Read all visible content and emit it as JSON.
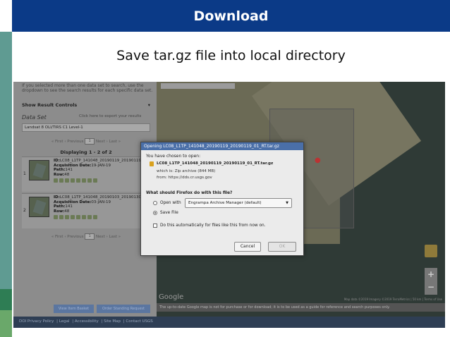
{
  "slide": {
    "title": "Download",
    "subtitle": "Save tar.gz file into local directory"
  },
  "left_panel": {
    "hint": "If you selected more than one data set to search, use the dropdown to see the search results for each specific data set.",
    "show_result_controls": "Show Result Controls",
    "data_set_label": "Data Set",
    "export_link": "Click here to export your results",
    "data_set_value": "Landsat 8 OLI/TIRS C1 Level-1",
    "pager": {
      "first": "« First",
      "previous": "‹ Previous",
      "page": "1",
      "next": "Next ›",
      "last": "Last »"
    },
    "displaying": "Displaying 1 - 2 of 2",
    "results": [
      {
        "num": "1",
        "id": "LC08_L1TP_141048_20190119_20190119_01_RT",
        "date": "19-JAN-19",
        "path": "141",
        "row": "48"
      },
      {
        "num": "2",
        "id": "LC08_L1TP_141048_20190103_20190130_01_T1",
        "date": "03-JAN-19",
        "path": "141",
        "row": "48"
      }
    ],
    "labels": {
      "id": "ID:",
      "acq": "Acquisition Date:",
      "path": "Path:",
      "row": "Row:"
    },
    "view_item_basket": "View Item Basket",
    "order_scene": "Order Standing Request"
  },
  "map": {
    "google": "Google",
    "attribution": "Map data ©2019 Imagery ©2019 TerraMetrics | 50 km | Terms of Use",
    "notice": "The up-to-date Google map is not for purchase or for download; it is to be used as a guide for reference and search purposes only.",
    "zoom_in": "+",
    "zoom_out": "−"
  },
  "footer": {
    "links": [
      "DOI Privacy Policy",
      "Legal",
      "Accessibility",
      "Site Map",
      "Contact USGS"
    ]
  },
  "dialog": {
    "title": "Opening LC08_L1TP_141048_20190119_20190119_01_RT.tar.gz",
    "chosen": "You have chosen to open:",
    "filename": "LC08_L1TP_141048_20190119_20190119_01_RT.tar.gz",
    "which_is": "which is: Zip archive (844 MB)",
    "from": "from: https://dds.cr.usgs.gov",
    "question": "What should Firefox do with this file?",
    "open_with": "Open with",
    "app": "Engrampa Archive Manager (default)",
    "save_file": "Save File",
    "auto": "Do this automatically for files like this from now on.",
    "cancel": "Cancel",
    "ok": "OK",
    "save_selected": true
  }
}
